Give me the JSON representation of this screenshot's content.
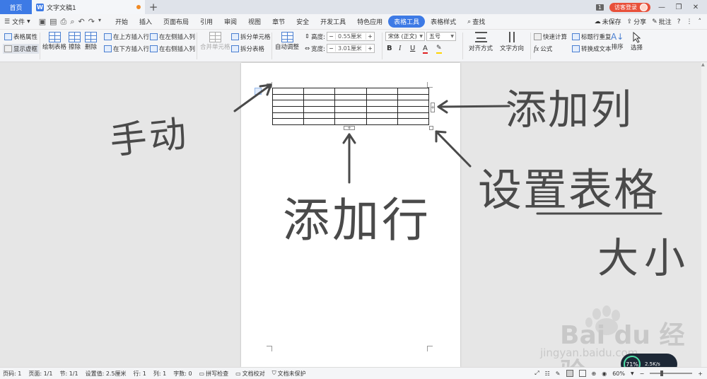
{
  "titlebar": {
    "home": "首页",
    "doc_tab": "文字文稿1",
    "doc_icon": "W",
    "new_tab": "+",
    "window_count": "1",
    "visitor_login": "访客登录",
    "minimize": "▢",
    "restore": "❐",
    "close": "✕"
  },
  "menubar": {
    "file": "文件",
    "items": [
      "开始",
      "插入",
      "页面布局",
      "引用",
      "审阅",
      "视图",
      "章节",
      "安全",
      "开发工具",
      "特色应用",
      "表格工具",
      "表格样式"
    ],
    "search": "查找",
    "unsaved": "未保存",
    "share": "分享",
    "comment": "批注"
  },
  "ribbon": {
    "table_props": "表格属性",
    "show_grid": "显示虚框",
    "draw_table": "绘制表格",
    "erase": "擦除",
    "delete": "删除",
    "insert_above": "在上方插入行",
    "insert_below": "在下方插入行",
    "insert_left": "在左侧插入列",
    "insert_right": "在右侧插入列",
    "merge_cells": "合并单元格",
    "split_cells": "拆分单元格",
    "split_table": "拆分表格",
    "auto_fit": "自动调整",
    "height_label": "高度:",
    "height_value": "0.55厘米",
    "width_label": "宽度:",
    "width_value": "3.01厘米",
    "font_name": "宋体 (正文)",
    "font_size": "五号",
    "bold": "B",
    "italic": "I",
    "underline": "U",
    "font_color": "A",
    "align": "对齐方式",
    "text_direction": "文字方向",
    "quick_calc": "快速计算",
    "title_repeat": "标题行重复",
    "formula": "公式",
    "convert_text": "转换成文本",
    "sort": "排序",
    "select": "选择"
  },
  "table": {
    "rows": 6,
    "cols": 5,
    "add_row": "+",
    "add_col": "+",
    "move": "+"
  },
  "annotations": {
    "move": "手动",
    "add_col": "添加列",
    "add_row": "添加行",
    "set_size_line1": "设置表格",
    "set_size_line2": "大小"
  },
  "watermark": {
    "brand": "Bai du 经验",
    "url": "jingyan.baidu.com"
  },
  "speed_widget": {
    "percent": "71%",
    "rate": "2.5K/s"
  },
  "statusbar": {
    "page_num": "页码: 1",
    "pages": "页面: 1/1",
    "section": "节: 1/1",
    "setting": "设置值: 2.5厘米",
    "row": "行: 1",
    "col": "列: 1",
    "words": "字数: 0",
    "spell": "拼写检查",
    "proof": "文档校对",
    "protect": "文档未保护",
    "zoom": "60%",
    "zoom_minus": "−",
    "zoom_plus": "+"
  }
}
